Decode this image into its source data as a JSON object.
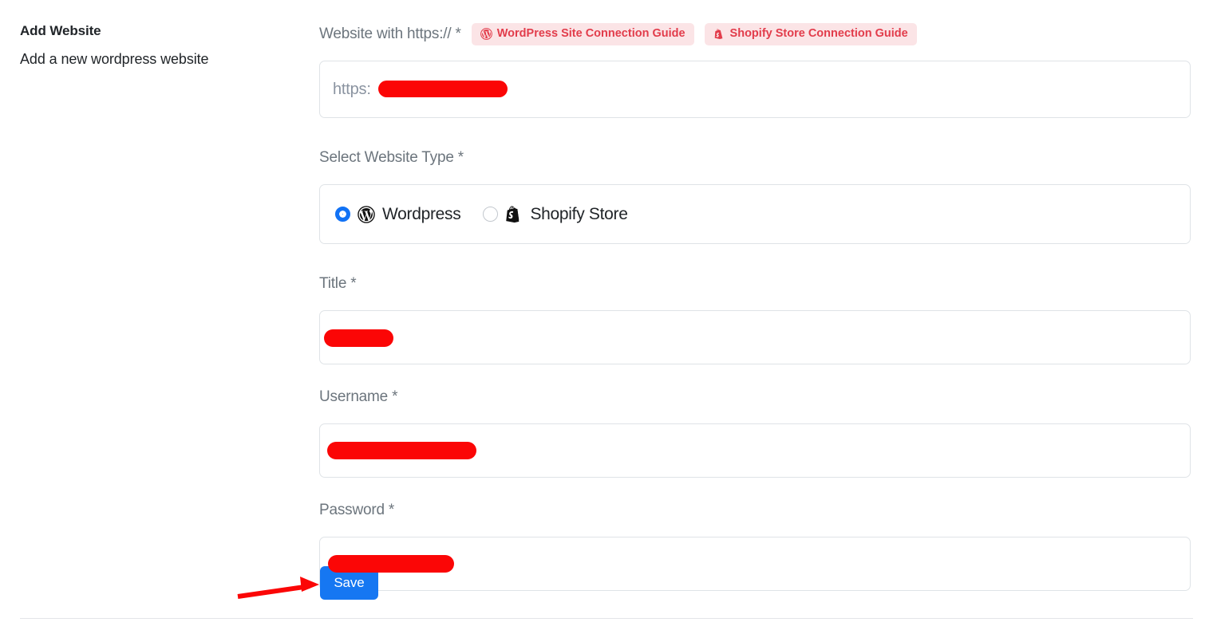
{
  "panel": {
    "title": "Add Website",
    "subtitle": "Add a new wordpress website"
  },
  "form": {
    "website_url": {
      "label": "Website with https:// *",
      "value": "https:",
      "redacted": true
    },
    "guides": [
      {
        "label": "WordPress Site Connection Guide",
        "icon": "wordpress-icon"
      },
      {
        "label": "Shopify Store Connection Guide",
        "icon": "shopify-icon"
      }
    ],
    "website_type": {
      "label": "Select Website Type *",
      "selected": "Wordpress",
      "options": [
        {
          "label": "Wordpress",
          "icon": "wordpress-icon",
          "checked": true
        },
        {
          "label": "Shopify Store",
          "icon": "shopify-icon",
          "checked": false
        }
      ]
    },
    "title_field": {
      "label": "Title *",
      "value": "",
      "redacted": true
    },
    "username_field": {
      "label": "Username *",
      "value": "",
      "redacted": true
    },
    "password_field": {
      "label": "Password *",
      "value": "",
      "redacted": true
    },
    "save_button": "Save"
  },
  "colors": {
    "accent_blue": "#1677f2",
    "badge_bg": "#fbe4e6",
    "badge_text": "#e23c4b",
    "redaction": "#fb0606",
    "label_gray": "#6c757d",
    "border": "#dfe3e7"
  }
}
